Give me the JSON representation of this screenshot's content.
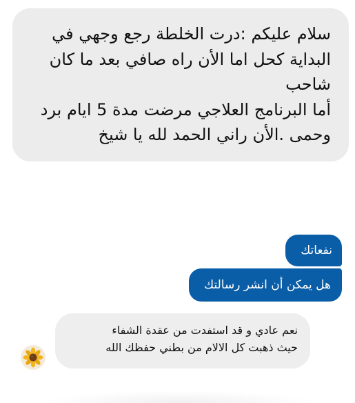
{
  "messages": {
    "incoming_long": {
      "line1": "سلام عليكم :درت الخلطة رجع وجهي في البداية كحل اما الأن راه صافي بعد ما كان شاحب",
      "line2": "أما البرنامج العلاجي مرضت مدة 5 ايام برد وحمى .الأن راني الحمد لله يا شيخ"
    },
    "outgoing_short": "نفعاتك",
    "outgoing_question": "هل يمكن أن انشر رسالتك",
    "incoming_reply": {
      "line1": "نعم عادي و قد استفدت من عقدة الشفاء",
      "line2": "حيث ذهبت كل الالام من بطني حفظك الله"
    }
  },
  "avatar": {
    "icon": "sunflower-avatar-icon"
  },
  "colors": {
    "incoming_bubble": "#ececec",
    "outgoing_bubble": "#0a5ea8",
    "outgoing_text": "#ffffff",
    "text": "#111111"
  }
}
